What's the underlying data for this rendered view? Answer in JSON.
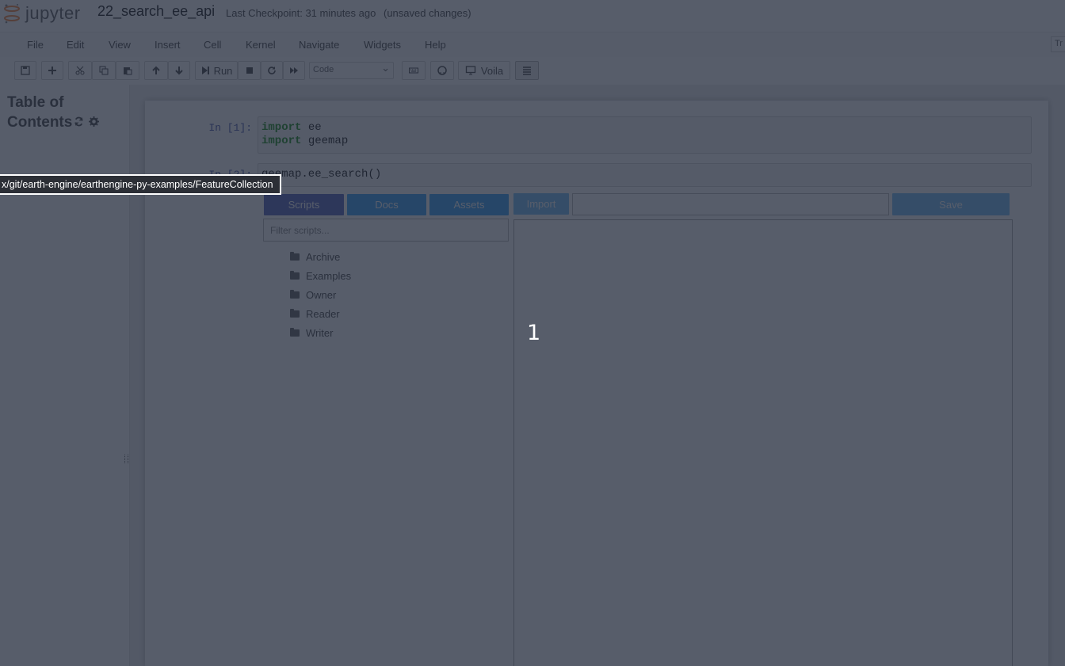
{
  "header": {
    "logo_text": "jupyter",
    "notebook_name": "22_search_ee_api",
    "checkpoint": "Last Checkpoint: 31 minutes ago",
    "autosave_status": "(unsaved changes)",
    "trusted_badge": "Tr"
  },
  "menu": [
    "File",
    "Edit",
    "View",
    "Insert",
    "Cell",
    "Kernel",
    "Navigate",
    "Widgets",
    "Help"
  ],
  "toolbar": {
    "run_label": "Run",
    "cell_type": "Code",
    "voila_label": "Voila",
    "icons": [
      "save-icon",
      "plus-icon",
      "cut-icon",
      "copy-icon",
      "paste-icon",
      "arrow-up-icon",
      "arrow-down-icon",
      "run-icon",
      "stop-icon",
      "restart-icon",
      "fast-forward-icon",
      "keyboard-icon",
      "github-icon",
      "monitor-icon",
      "list-icon"
    ]
  },
  "toc": {
    "title": "Table of Contents"
  },
  "cells": [
    {
      "prompt": "In [1]:",
      "lines": [
        [
          "import",
          " ee"
        ],
        [
          "import",
          " geemap"
        ]
      ]
    },
    {
      "prompt": "In [2]:",
      "code": "geemap.ee_search()"
    }
  ],
  "widget": {
    "tabs": [
      "Scripts",
      "Docs",
      "Assets"
    ],
    "import_label": "Import",
    "save_label": "Save",
    "filter_placeholder": "Filter scripts...",
    "tree": [
      "Archive",
      "Examples",
      "Owner",
      "Reader",
      "Writer"
    ],
    "tab_colors": [
      "#3f51b5",
      "#2196f3",
      "#2196f3"
    ],
    "import_color": "#64b5f6",
    "save_color": "#64b5f6"
  },
  "overlay": {
    "tooltip": "x/git/earth-engine/earthengine-py-examples/FeatureCollection",
    "marker": "1"
  }
}
